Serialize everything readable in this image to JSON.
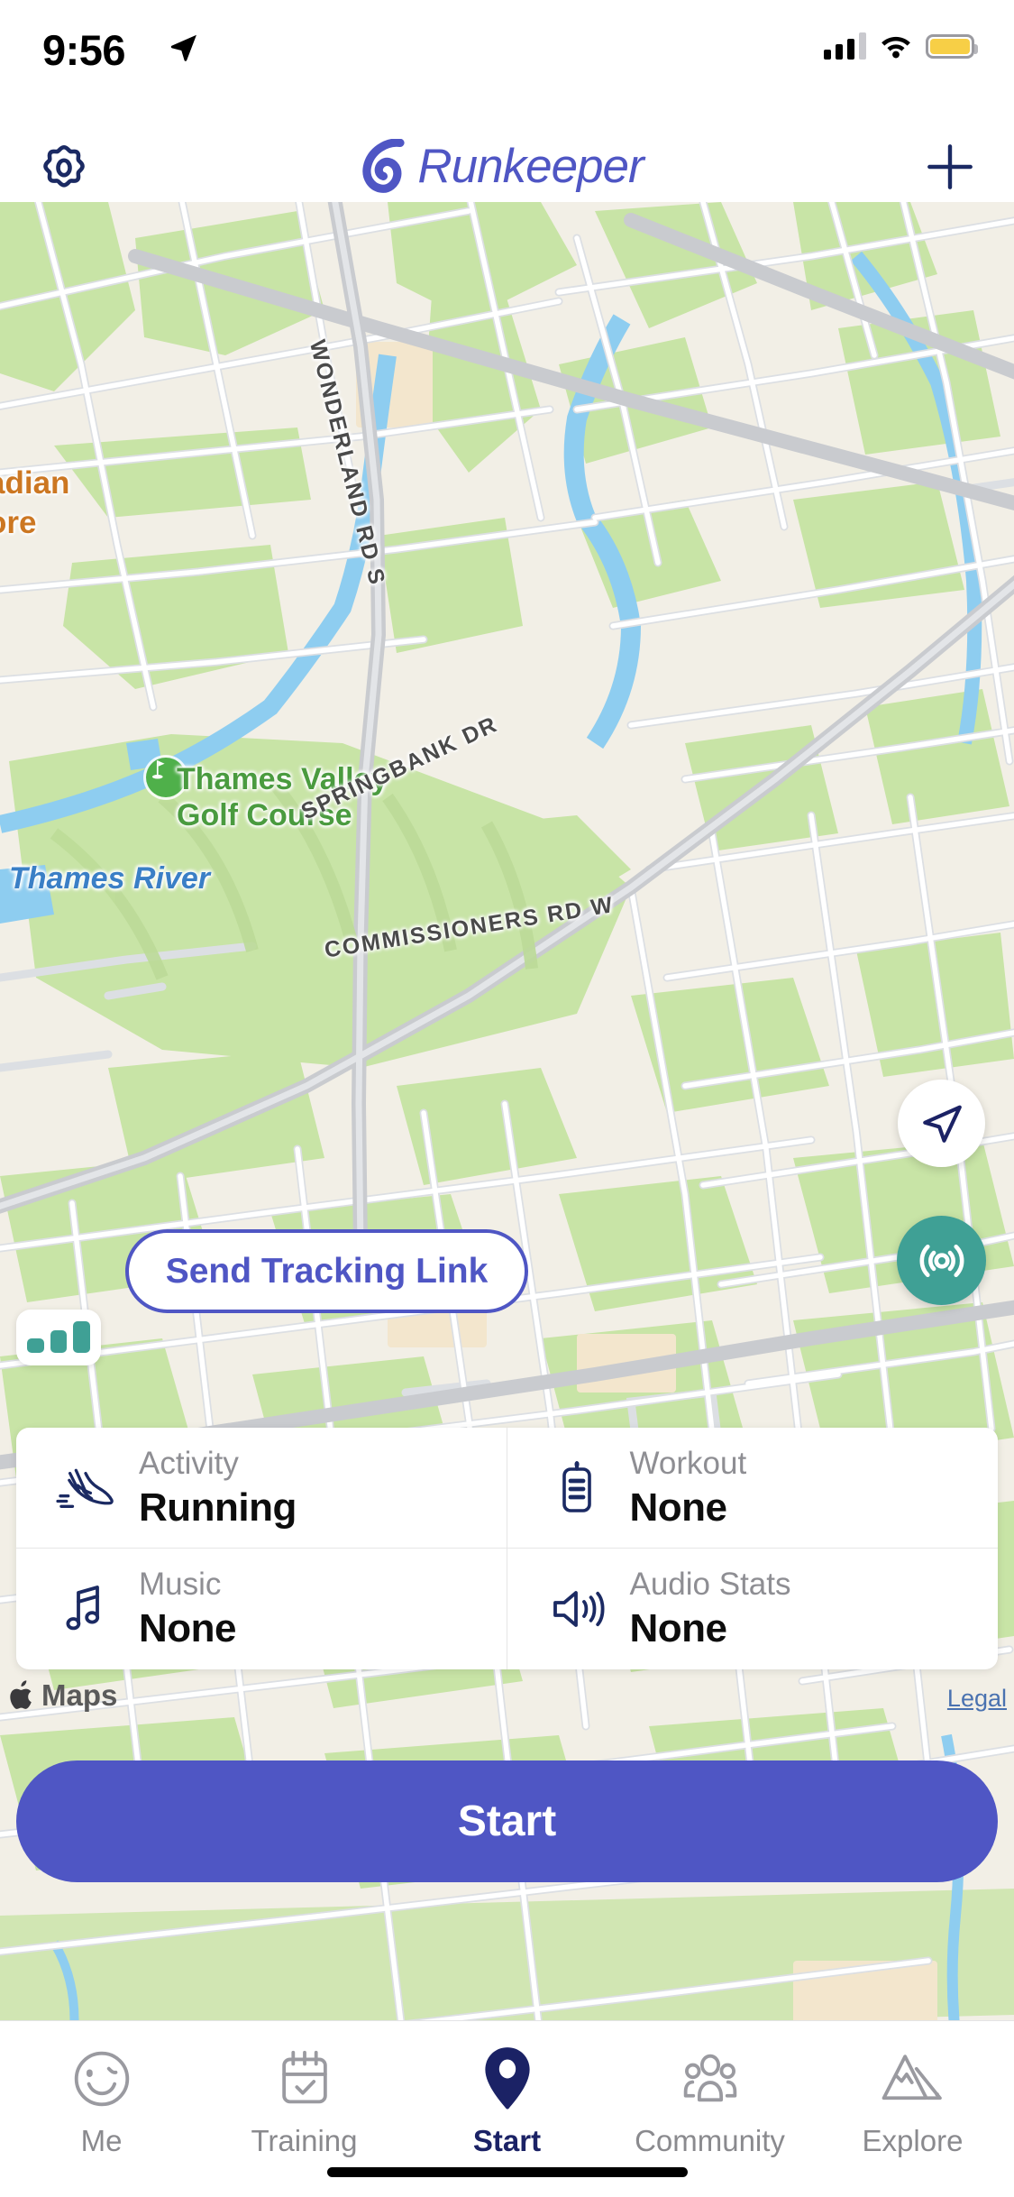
{
  "status_bar": {
    "time": "9:56",
    "location_icon": "location-arrow-icon",
    "cellular_icon": "cellular-bars-icon",
    "wifi_icon": "wifi-icon",
    "battery_icon": "battery-low-power-icon",
    "battery_color": "#f7cf46"
  },
  "nav_bar": {
    "settings_icon": "gear-icon",
    "brand_name": "Runkeeper",
    "brand_mark_icon": "asics-spiral-icon",
    "brand_color": "#4f56c4",
    "add_icon": "plus-icon"
  },
  "map": {
    "provider_attribution": "Maps",
    "legal_link": "Legal",
    "labels": {
      "poi_orange": "adian\nore",
      "golf_course": "Thames Valley",
      "golf_course_line2": "Golf Course",
      "river": "Thames River",
      "road_wonderland": "WONDERLAND RD S",
      "road_springbank": "SPRINGBANK DR",
      "road_commissioners": "COMMISSIONERS RD W"
    },
    "colors": {
      "land": "#f2efe6",
      "park": "#c6e3a4",
      "water": "#8ecdf0",
      "road": "#ffffff",
      "road_casing": "#d9dce0",
      "highway": "#c9cbcf"
    },
    "controls": {
      "gps_signal_icon": "gps-signal-bars-icon",
      "gps_signal_level": 3,
      "locate_icon": "navigation-arrow-icon",
      "live_tracking_icon": "broadcast-icon",
      "live_tracking_color": "#3fa095",
      "tracking_link_label": "Send Tracking Link"
    }
  },
  "options": [
    {
      "icon": "running-shoe-icon",
      "label": "Activity",
      "value": "Running"
    },
    {
      "icon": "clipboard-icon",
      "label": "Workout",
      "value": "None"
    },
    {
      "icon": "music-note-icon",
      "label": "Music",
      "value": "None"
    },
    {
      "icon": "speaker-icon",
      "label": "Audio Stats",
      "value": "None"
    }
  ],
  "start_button": {
    "label": "Start",
    "color": "#4f56c4"
  },
  "tab_bar": {
    "active_index": 2,
    "items": [
      {
        "icon": "smiley-face-icon",
        "label": "Me"
      },
      {
        "icon": "calendar-check-icon",
        "label": "Training"
      },
      {
        "icon": "map-pin-icon",
        "label": "Start"
      },
      {
        "icon": "people-group-icon",
        "label": "Community"
      },
      {
        "icon": "mountains-icon",
        "label": "Explore"
      }
    ]
  }
}
